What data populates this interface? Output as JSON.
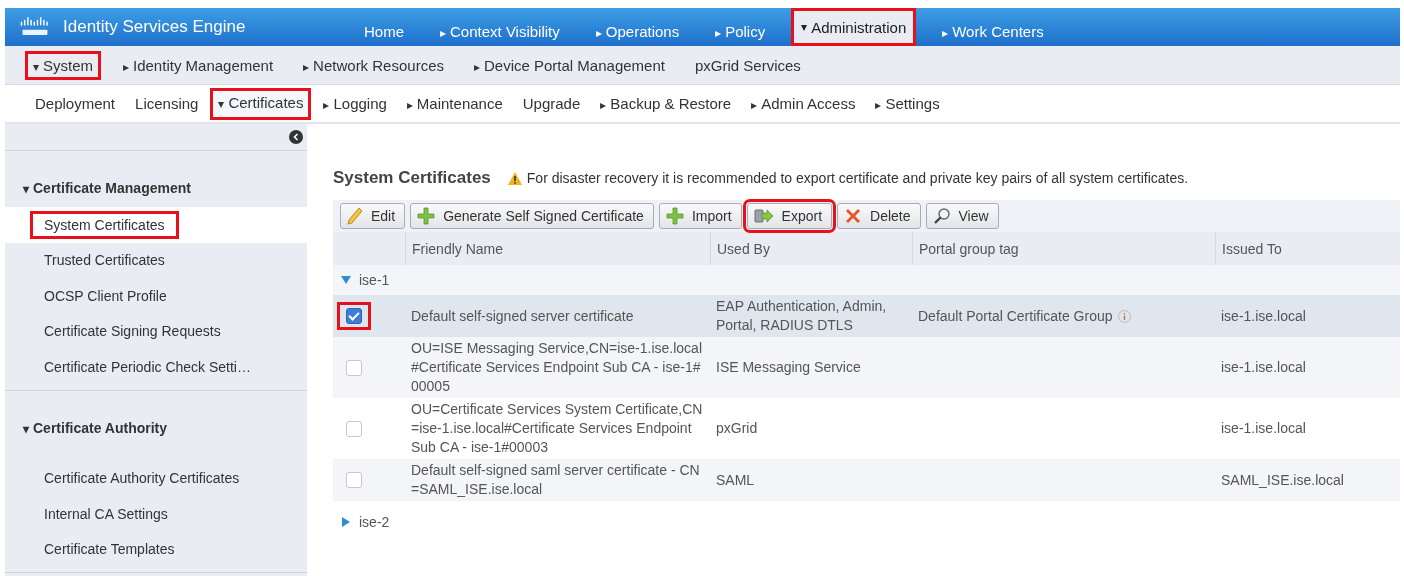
{
  "header": {
    "product": "Identity Services Engine",
    "tabs": [
      {
        "label": "Home",
        "selected": false,
        "highlighted": false
      },
      {
        "arrow": "▸",
        "label": "Context Visibility",
        "selected": false,
        "highlighted": false
      },
      {
        "arrow": "▸",
        "label": "Operations",
        "selected": false,
        "highlighted": false
      },
      {
        "arrow": "▸",
        "label": "Policy",
        "selected": false,
        "highlighted": false
      },
      {
        "arrow": "▾",
        "label": "Administration",
        "selected": true,
        "highlighted": true
      },
      {
        "arrow": "▸",
        "label": "Work Centers",
        "selected": false,
        "highlighted": false
      }
    ]
  },
  "subnav": [
    {
      "arrow": "▾",
      "label": "System",
      "highlighted": true
    },
    {
      "arrow": "▸",
      "label": "Identity Management",
      "highlighted": false
    },
    {
      "arrow": "▸",
      "label": "Network Resources",
      "highlighted": false
    },
    {
      "arrow": "▸",
      "label": "Device Portal Management",
      "highlighted": false
    },
    {
      "label": "pxGrid Services",
      "highlighted": false
    }
  ],
  "tertiary_nav": [
    {
      "label": "Deployment",
      "selected": false,
      "highlighted": false
    },
    {
      "label": "Licensing",
      "selected": false,
      "highlighted": false
    },
    {
      "arrow": "▾",
      "label": "Certificates",
      "selected": true,
      "highlighted": true
    },
    {
      "arrow": "▸",
      "label": "Logging",
      "selected": false,
      "highlighted": false
    },
    {
      "arrow": "▸",
      "label": "Maintenance",
      "selected": false,
      "highlighted": false
    },
    {
      "label": "Upgrade",
      "selected": false,
      "highlighted": false
    },
    {
      "arrow": "▸",
      "label": "Backup & Restore",
      "selected": false,
      "highlighted": false
    },
    {
      "arrow": "▸",
      "label": "Admin Access",
      "selected": false,
      "highlighted": false
    },
    {
      "arrow": "▸",
      "label": "Settings",
      "selected": false,
      "highlighted": false
    }
  ],
  "sidebar": {
    "sections": [
      {
        "title": "Certificate Management",
        "expanded": true,
        "items": [
          {
            "label": "System Certificates",
            "selected": true,
            "highlighted": true
          },
          {
            "label": "Trusted Certificates",
            "selected": false,
            "highlighted": false
          },
          {
            "label": "OCSP Client Profile",
            "selected": false,
            "highlighted": false
          },
          {
            "label": "Certificate Signing Requests",
            "selected": false,
            "highlighted": false
          },
          {
            "label": "Certificate Periodic Check Setti…",
            "selected": false,
            "highlighted": false
          }
        ]
      },
      {
        "title": "Certificate Authority",
        "expanded": true,
        "items": [
          {
            "label": "Certificate Authority Certificates",
            "selected": false,
            "highlighted": false
          },
          {
            "label": "Internal CA Settings",
            "selected": false,
            "highlighted": false
          },
          {
            "label": "Certificate Templates",
            "selected": false,
            "highlighted": false
          }
        ]
      }
    ]
  },
  "main": {
    "title": "System Certificates",
    "warning": "For disaster recovery it is recommended to export certificate and private key pairs of all system certificates.",
    "toolbar": [
      {
        "label": "Edit",
        "kind": "edit",
        "highlighted": false
      },
      {
        "label": "Generate Self Signed Certificate",
        "kind": "add",
        "highlighted": false
      },
      {
        "label": "Import",
        "kind": "add",
        "highlighted": false
      },
      {
        "label": "Export",
        "kind": "export",
        "highlighted": true
      },
      {
        "label": "Delete",
        "kind": "delete",
        "highlighted": false
      },
      {
        "label": "View",
        "kind": "view",
        "highlighted": false
      }
    ],
    "table": {
      "columns": [
        "Friendly Name",
        "Used By",
        "Portal group tag",
        "Issued To"
      ],
      "groups": [
        {
          "name": "ise-1",
          "expanded": true,
          "rows": [
            {
              "cells": [
                "Default self-signed server certificate",
                "EAP Authentication, Admin, Portal, RADIUS DTLS",
                "Default Portal Certificate Group",
                "ise-1.ise.local"
              ],
              "info": true,
              "checked": true,
              "selected": true,
              "highlighted": true
            },
            {
              "cells": [
                "OU=ISE Messaging Service,CN=ise-1.ise.local#Certificate Services Endpoint Sub CA - ise-1#00005",
                "ISE Messaging Service",
                "",
                "ise-1.ise.local"
              ],
              "info": false,
              "checked": false,
              "selected": false,
              "highlighted": false
            },
            {
              "cells": [
                "OU=Certificate Services System Certificate,CN=ise-1.ise.local#Certificate Services Endpoint Sub CA - ise-1#00003",
                "pxGrid",
                "",
                "ise-1.ise.local"
              ],
              "info": false,
              "checked": false,
              "selected": false,
              "highlighted": false
            },
            {
              "cells": [
                "Default self-signed saml server certificate - CN=SAML_ISE.ise.local",
                "SAML",
                "",
                "SAML_ISE.ise.local"
              ],
              "info": false,
              "checked": false,
              "selected": false,
              "highlighted": false
            }
          ]
        },
        {
          "name": "ise-2",
          "expanded": false
        }
      ]
    }
  }
}
